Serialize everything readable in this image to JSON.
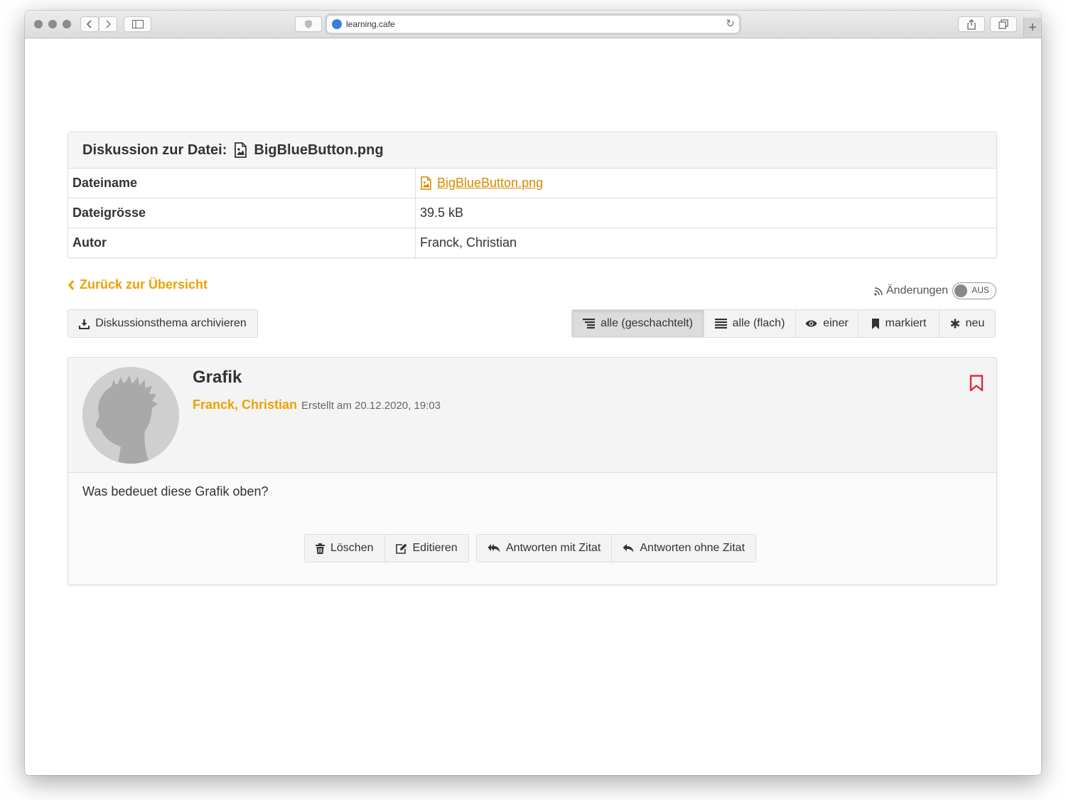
{
  "browser": {
    "url": "learning.cafe",
    "new_tab": "+"
  },
  "discussion": {
    "header_prefix": "Diskussion zur Datei:",
    "header_filename": "BigBlueButton.png",
    "rows": [
      {
        "key": "Dateiname",
        "value": "BigBlueButton.png",
        "link": true
      },
      {
        "key": "Dateigrösse",
        "value": "39.5 kB"
      },
      {
        "key": "Autor",
        "value": "Franck, Christian"
      }
    ]
  },
  "nav": {
    "back_label": "Zurück zur Übersicht",
    "changes_label": "Änderungen",
    "toggle_label": "AUS"
  },
  "toolbar": {
    "archive_label": "Diskussionsthema archivieren",
    "views": [
      {
        "label": "alle (geschachtelt)",
        "icon": "indent-list-icon",
        "active": true
      },
      {
        "label": "alle (flach)",
        "icon": "list-icon"
      },
      {
        "label": "einer",
        "icon": "eye-icon"
      },
      {
        "label": "markiert",
        "icon": "bookmark-icon"
      },
      {
        "label": "neu",
        "icon": "asterisk-icon"
      }
    ]
  },
  "post": {
    "title": "Grafik",
    "author": "Franck, Christian",
    "date": "Erstellt am 20.12.2020, 19:03",
    "body": "Was bedeuet diese Grafik oben?",
    "actions": {
      "delete": "Löschen",
      "edit": "Editieren",
      "reply_quote": "Antworten mit Zitat",
      "reply_noquote": "Antworten ohne Zitat"
    }
  },
  "colors": {
    "accent": "#f0a000",
    "link": "#d98a00",
    "bookmark": "#e0293d"
  }
}
